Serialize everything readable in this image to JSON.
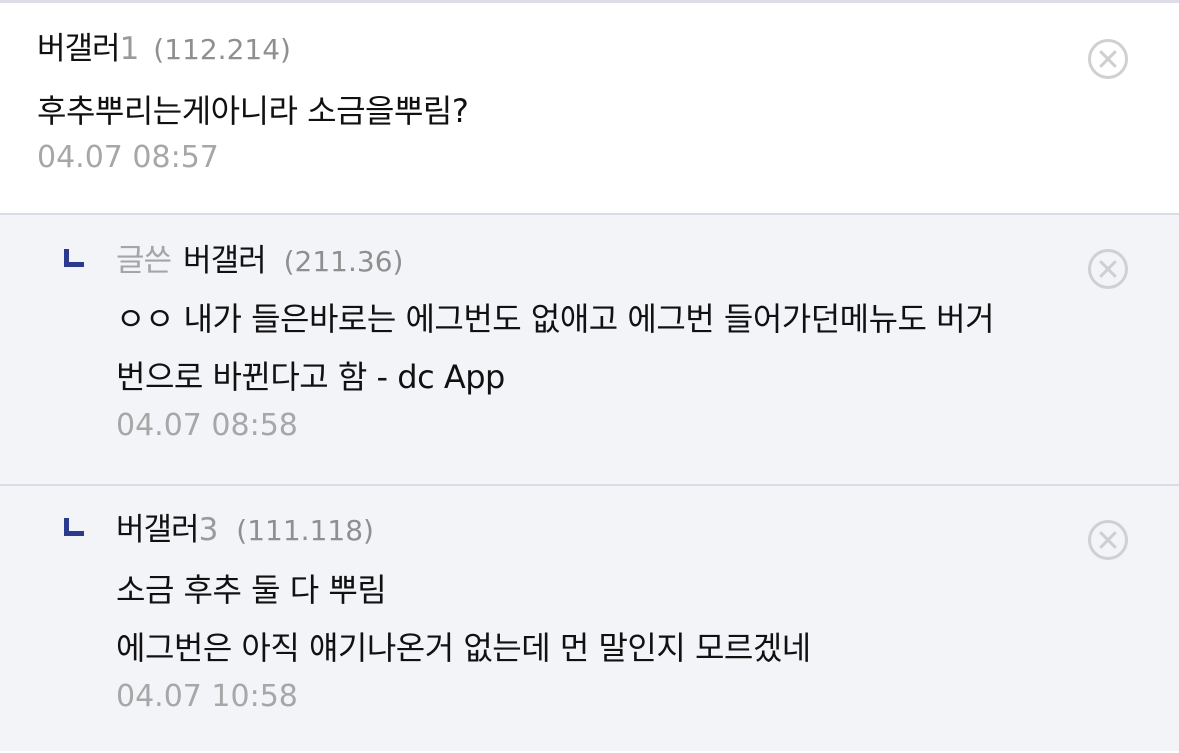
{
  "comments": [
    {
      "nick": "버갤러",
      "nick_num": "1",
      "ip": "(112.214)",
      "lines": [
        "후추뿌리는게아니라 소금을뿌림?"
      ],
      "time": "04.07 08:57"
    },
    {
      "writer_tag": "글쓴",
      "nick": "버갤러",
      "nick_num": "",
      "ip": "(211.36)",
      "lines": [
        "ㅇㅇ 내가 들은바로는 에그번도 없애고 에그번 들어가던메뉴도 버거",
        "번으로 바뀐다고 함 - dc App"
      ],
      "time": "04.07 08:58"
    },
    {
      "nick": "버갤러",
      "nick_num": "3",
      "ip": "(111.118)",
      "lines": [
        "소금 후추 둘 다 뿌림",
        "에그번은 아직 얘기나온거 없는데 먼 말인지 모르겠네"
      ],
      "time": "04.07 10:58"
    }
  ],
  "colors": {
    "reply_background": "#f3f4f8",
    "reply_mark": "#2a3a8c",
    "meta_gray": "#a7a7a7"
  },
  "icons": {
    "delete": "close-circle-icon",
    "reply": "reply-corner-icon"
  }
}
